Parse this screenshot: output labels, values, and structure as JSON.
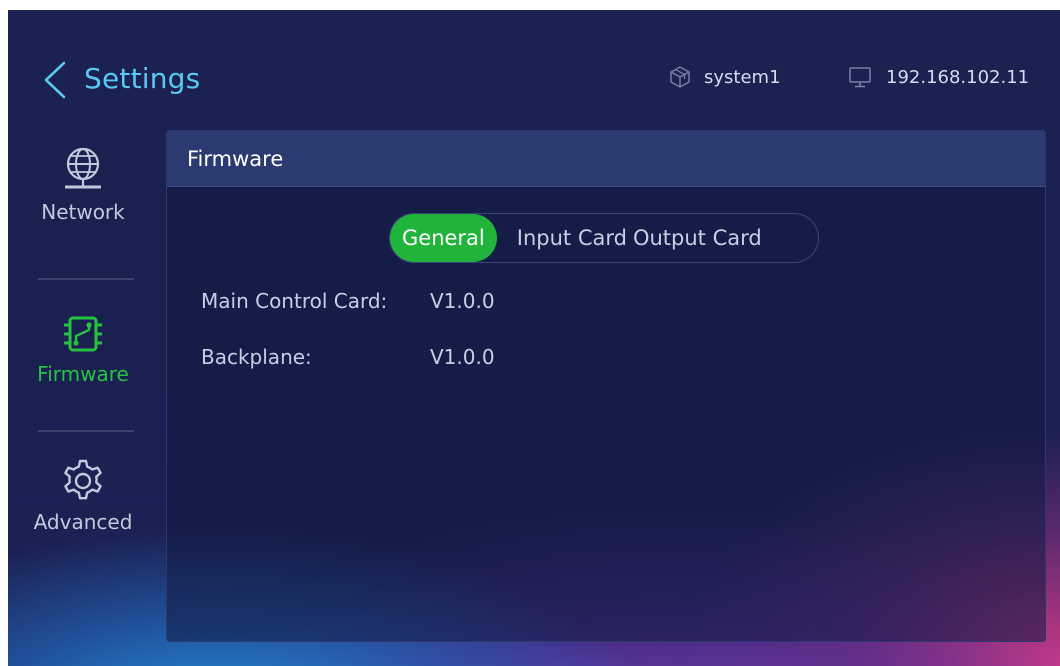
{
  "header": {
    "title": "Settings",
    "system_name": "system1",
    "ip_address": "192.168.102.11"
  },
  "sidebar": {
    "items": [
      {
        "label": "Network",
        "icon": "globe-icon",
        "active": false
      },
      {
        "label": "Firmware",
        "icon": "circuit-board-icon",
        "active": true
      },
      {
        "label": "Advanced",
        "icon": "gear-icon",
        "active": false
      }
    ]
  },
  "panel": {
    "title": "Firmware",
    "tabs": [
      {
        "label": "General",
        "active": true
      },
      {
        "label": "Input Card",
        "active": false
      },
      {
        "label": "Output Card",
        "active": false
      }
    ],
    "rows": [
      {
        "label": "Main Control Card:",
        "value": "V1.0.0"
      },
      {
        "label": "Backplane:",
        "value": "V1.0.0"
      }
    ]
  },
  "colors": {
    "accent_green": "#20b53a",
    "title_blue": "#59c8f2",
    "background": "#1b2150"
  }
}
